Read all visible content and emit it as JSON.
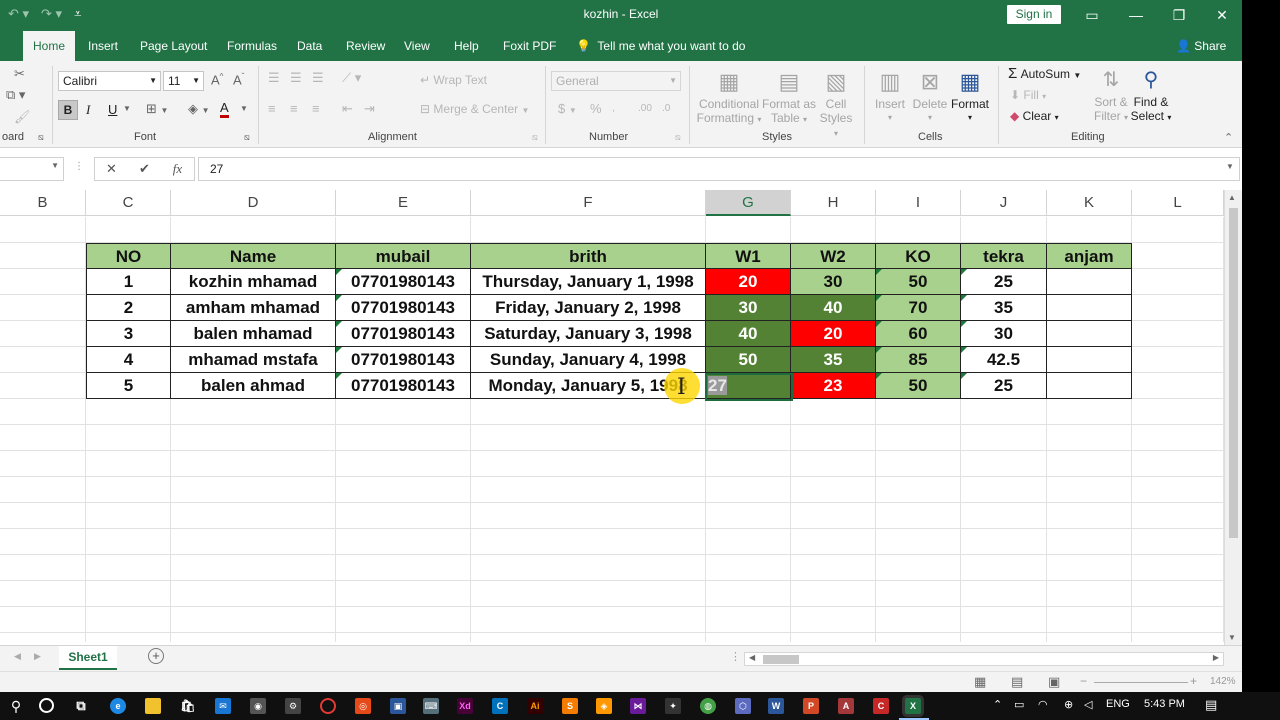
{
  "app": {
    "title": "kozhin  -  Excel",
    "signin": "Sign in",
    "window_controls": [
      "minimize-icon",
      "restore-icon",
      "close-icon"
    ]
  },
  "tabs": [
    "Home",
    "Insert",
    "Page Layout",
    "Formulas",
    "Data",
    "Review",
    "View",
    "Help",
    "Foxit PDF"
  ],
  "active_tab": "Home",
  "tellme": "Tell me what you want to do",
  "share": "Share",
  "ribbon": {
    "clipboard_label": "oard",
    "font_name": "Calibri",
    "font_size": "11",
    "font_label": "Font",
    "bold": "B",
    "italic": "I",
    "underline": "U",
    "alignment_label": "Alignment",
    "wrap_text": "Wrap Text",
    "merge_center": "Merge & Center",
    "number_format": "General",
    "number_label": "Number",
    "currency": "$",
    "percent": "%",
    "conditional_formatting": [
      "Conditional",
      "Formatting"
    ],
    "format_as_table": [
      "Format as",
      "Table"
    ],
    "cell_styles": [
      "Cell",
      "Styles"
    ],
    "styles_label": "Styles",
    "insert": "Insert",
    "delete": "Delete",
    "format": "Format",
    "cells_label": "Cells",
    "autosum": "AutoSum",
    "fill": "Fill",
    "clear": "Clear",
    "sort_filter": [
      "Sort &",
      "Filter"
    ],
    "find_select": [
      "Find &",
      "Select"
    ],
    "editing_label": "Editing"
  },
  "formula_bar": {
    "value": "27",
    "cancel": "✕",
    "enter": "✔",
    "fx": "fx"
  },
  "columns": [
    "B",
    "C",
    "D",
    "E",
    "F",
    "G",
    "H",
    "I",
    "J",
    "K",
    "L"
  ],
  "selected_column": "G",
  "table": {
    "headers": [
      "NO",
      "Name",
      "mubail",
      "brith",
      "W1",
      "W2",
      "KO",
      "tekra",
      "anjam"
    ],
    "rows": [
      [
        "1",
        "kozhin mhamad",
        "07701980143",
        "Thursday, January 1, 1998",
        "20",
        "30",
        "50",
        "25",
        ""
      ],
      [
        "2",
        "amham mhamad",
        "07701980143",
        "Friday, January 2, 1998",
        "30",
        "40",
        "70",
        "35",
        ""
      ],
      [
        "3",
        "balen mhamad",
        "07701980143",
        "Saturday, January 3, 1998",
        "40",
        "20",
        "60",
        "30",
        ""
      ],
      [
        "4",
        "mhamad mstafa",
        "07701980143",
        "Sunday, January 4, 1998",
        "50",
        "35",
        "85",
        "42.5",
        ""
      ],
      [
        "5",
        "balen ahmad",
        "07701980143",
        "Monday, January 5, 1998",
        "27",
        "23",
        "50",
        "25",
        ""
      ]
    ],
    "colors": {
      "header": "#a9d18e",
      "light_green": "#a9d18e",
      "dark_green": "#548235",
      "red": "#ff0000"
    }
  },
  "sheet_tab": "Sheet1",
  "status": {
    "zoom": "142%"
  },
  "taskbar": {
    "lang": "ENG",
    "time": "5:43 PM"
  }
}
